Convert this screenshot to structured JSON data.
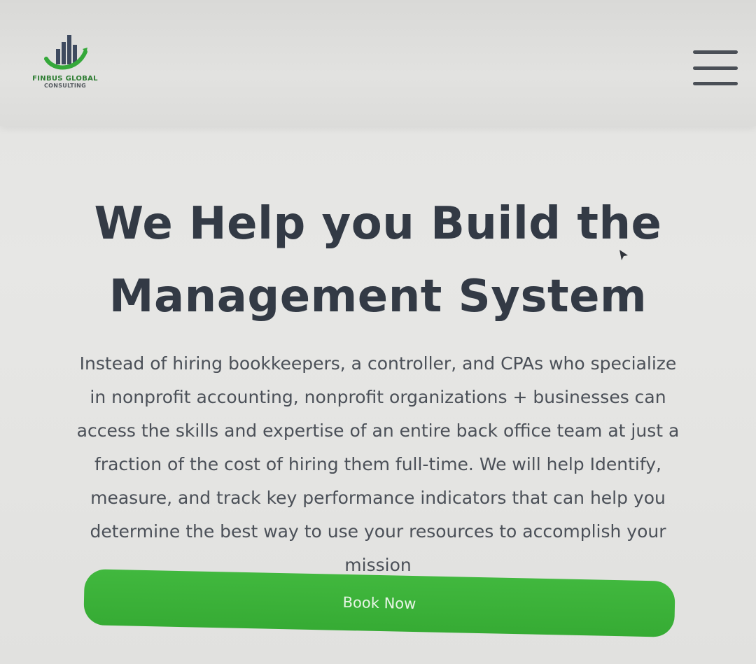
{
  "header": {
    "logo": {
      "name": "FINBUS GLOBAL",
      "subtitle": "CONSULTING",
      "icon": "bar-chart-swoosh-logo"
    },
    "menu": {
      "icon": "hamburger-menu-icon"
    }
  },
  "hero": {
    "title": "We Help you Build the Management System",
    "description": "Instead of hiring bookkeepers, a controller, and CPAs who specialize in nonprofit accounting, nonprofit organizations + businesses can access the skills and expertise of an entire back office team at just a fraction of the cost of hiring them full-time. We will help Identify, measure, and track key performance indicators that can help you determine the best way to use your resources to accomplish your mission",
    "cta_label": "Book Now"
  },
  "colors": {
    "brand_green": "#3db53b",
    "heading_text": "#333a45",
    "body_text": "#4b5058",
    "background": "#e4e4e2"
  }
}
